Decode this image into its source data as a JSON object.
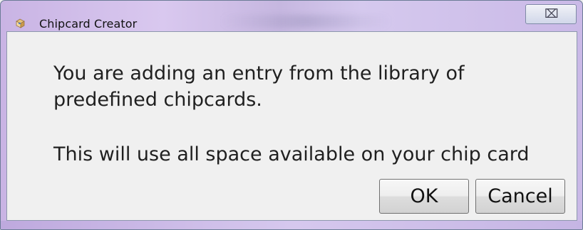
{
  "window": {
    "title": "Chipcard Creator",
    "close_symbol": "⌧"
  },
  "dialog": {
    "message_part1": "You are adding an entry from the library of predefined chipcards.",
    "message_part2": "This will use all space available on your chip card"
  },
  "buttons": {
    "ok_label": "OK",
    "cancel_label": "Cancel"
  },
  "icons": {
    "app_icon": "chipcard-app-icon",
    "close_icon": "close-icon"
  },
  "colors": {
    "title_bar_accent": "#cab9e7",
    "dialog_background": "#f0f0f0",
    "button_border": "#707070"
  }
}
